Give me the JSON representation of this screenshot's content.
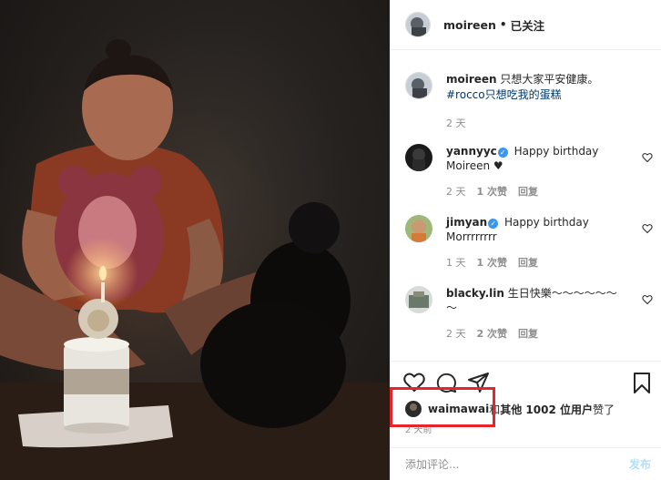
{
  "post": {
    "username": "moireen",
    "separator": "•",
    "follow_status": "已关注"
  },
  "caption": {
    "username": "moireen",
    "text": " 只想大家平安健康。",
    "hashtag": "#rocco只想吃我的蛋糕",
    "time": "2 天"
  },
  "comments": [
    {
      "username": "yannyyc",
      "verified": true,
      "text": "Happy birthday Moireen ♥",
      "time": "2 天",
      "likes": "1 次赞",
      "reply": "回复"
    },
    {
      "username": "jimyan",
      "verified": true,
      "text": "Happy birthday Morrrrrrrr",
      "time": "1 天",
      "likes": "1 次赞",
      "reply": "回复"
    },
    {
      "username": "blacky.lin",
      "verified": false,
      "text": "生日快樂～～～～～～～",
      "time": "2 天",
      "likes": "2 次赞",
      "reply": "回复"
    }
  ],
  "likes": {
    "username": "waimawai",
    "and": " 和 ",
    "others": "其他 1002 位用户",
    "suffix": " 赞了"
  },
  "post_time": "2 天前",
  "comment_box": {
    "placeholder": "添加评论...",
    "post_button": "发布"
  },
  "icons": {
    "like": "heart-icon",
    "comment": "comment-icon",
    "share": "paper-plane-icon",
    "save": "bookmark-icon",
    "comment_like": "heart-icon"
  },
  "colors": {
    "hashtag": "#00376b",
    "verified": "#3897f0",
    "highlight_box": "#e8232a",
    "post_button_disabled": "#b2dffc"
  }
}
